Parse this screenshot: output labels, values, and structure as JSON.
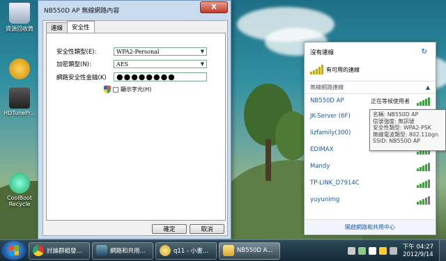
{
  "desktop": {
    "icons": [
      {
        "label": "資源回收筒"
      },
      {
        "label": ""
      },
      {
        "label": "HDTunePr..."
      },
      {
        "label": "CoolBoot Recycle"
      }
    ]
  },
  "dialog": {
    "title": "NB550D AP 無線網路內容",
    "close_label": "X",
    "tabs": [
      "連線",
      "安全性"
    ],
    "security_type_label": "安全性類型(E):",
    "security_type_value": "WPA2-Personal",
    "encryption_type_label": "加密類型(N):",
    "encryption_type_value": "AES",
    "key_label": "網路安全性金鑰(K)",
    "key_value": "●●●●●●●●",
    "show_chars_label": "顯示字元(H)",
    "ok_label": "確定",
    "cancel_label": "取消"
  },
  "flyout": {
    "no_connection": "沒有連線",
    "available_connections": "有可用的連線",
    "section_label": "無線網路連線",
    "networks": [
      {
        "name": "NB550D AP",
        "status": "正在等候使用者",
        "signal": 5
      },
      {
        "name": "JK-Server  (6F)",
        "status": "",
        "signal": 5
      },
      {
        "name": "lizfamily(300)",
        "status": "",
        "signal": 5
      },
      {
        "name": "EDIMAX",
        "status": "",
        "signal": 4
      },
      {
        "name": "Mandy",
        "status": "",
        "signal": 4
      },
      {
        "name": "TP-LINK_D7914C",
        "status": "",
        "signal": 4
      },
      {
        "name": "yuyunimg",
        "status": "",
        "signal": 3
      }
    ],
    "footer_link": "開啟網路和共用中心"
  },
  "tooltip": {
    "lines": [
      "名稱: NB550D AP",
      "信號強度: 無訊號",
      "安全性類型: WPA2-PSK",
      "無線電波類型: 802.11bgn",
      "SSID: NB550D AP"
    ]
  },
  "taskbar": {
    "buttons": [
      {
        "label": "討論群組發...",
        "icon": "chrome-icon"
      },
      {
        "label": "網路和共用...",
        "icon": "network-icon"
      },
      {
        "label": "q11 - 小畫...",
        "icon": "paint-icon"
      },
      {
        "label": "NB550D A...",
        "icon": "folder-icon"
      }
    ],
    "time": "下午 04:27",
    "date": "2012/9/14"
  },
  "colors": {
    "link_blue": "#1f56a8",
    "signal_green": "#3aa53a",
    "signal_gold": "#d8a400",
    "dialog_frame": "#c8dbef"
  }
}
